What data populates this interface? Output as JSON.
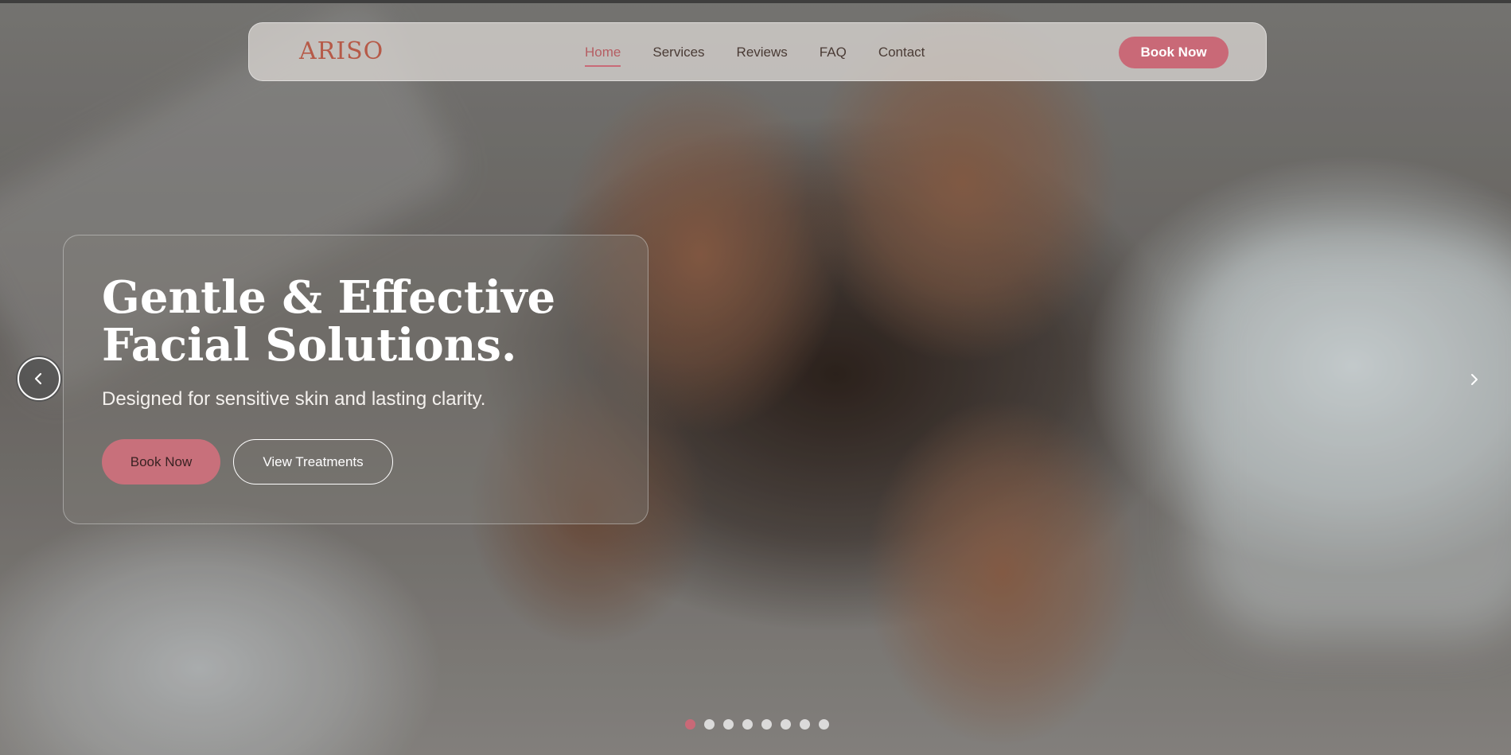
{
  "brand": {
    "logo_text": "ARISO",
    "accent_color": "#c96977",
    "logo_color": "#b65a48"
  },
  "nav": {
    "links": [
      {
        "label": "Home",
        "active": true
      },
      {
        "label": "Services",
        "active": false
      },
      {
        "label": "Reviews",
        "active": false
      },
      {
        "label": "FAQ",
        "active": false
      },
      {
        "label": "Contact",
        "active": false
      }
    ],
    "cta_label": "Book Now"
  },
  "hero": {
    "title_line1": "Gentle & Effective",
    "title_line2": "Facial Solutions.",
    "subtitle": "Designed for sensitive skin and lasting clarity.",
    "primary_button": "Book Now",
    "secondary_button": "View Treatments"
  },
  "carousel": {
    "prev_icon": "chevron-left-icon",
    "next_icon": "chevron-right-icon",
    "slide_count": 8,
    "active_slide": 1
  }
}
